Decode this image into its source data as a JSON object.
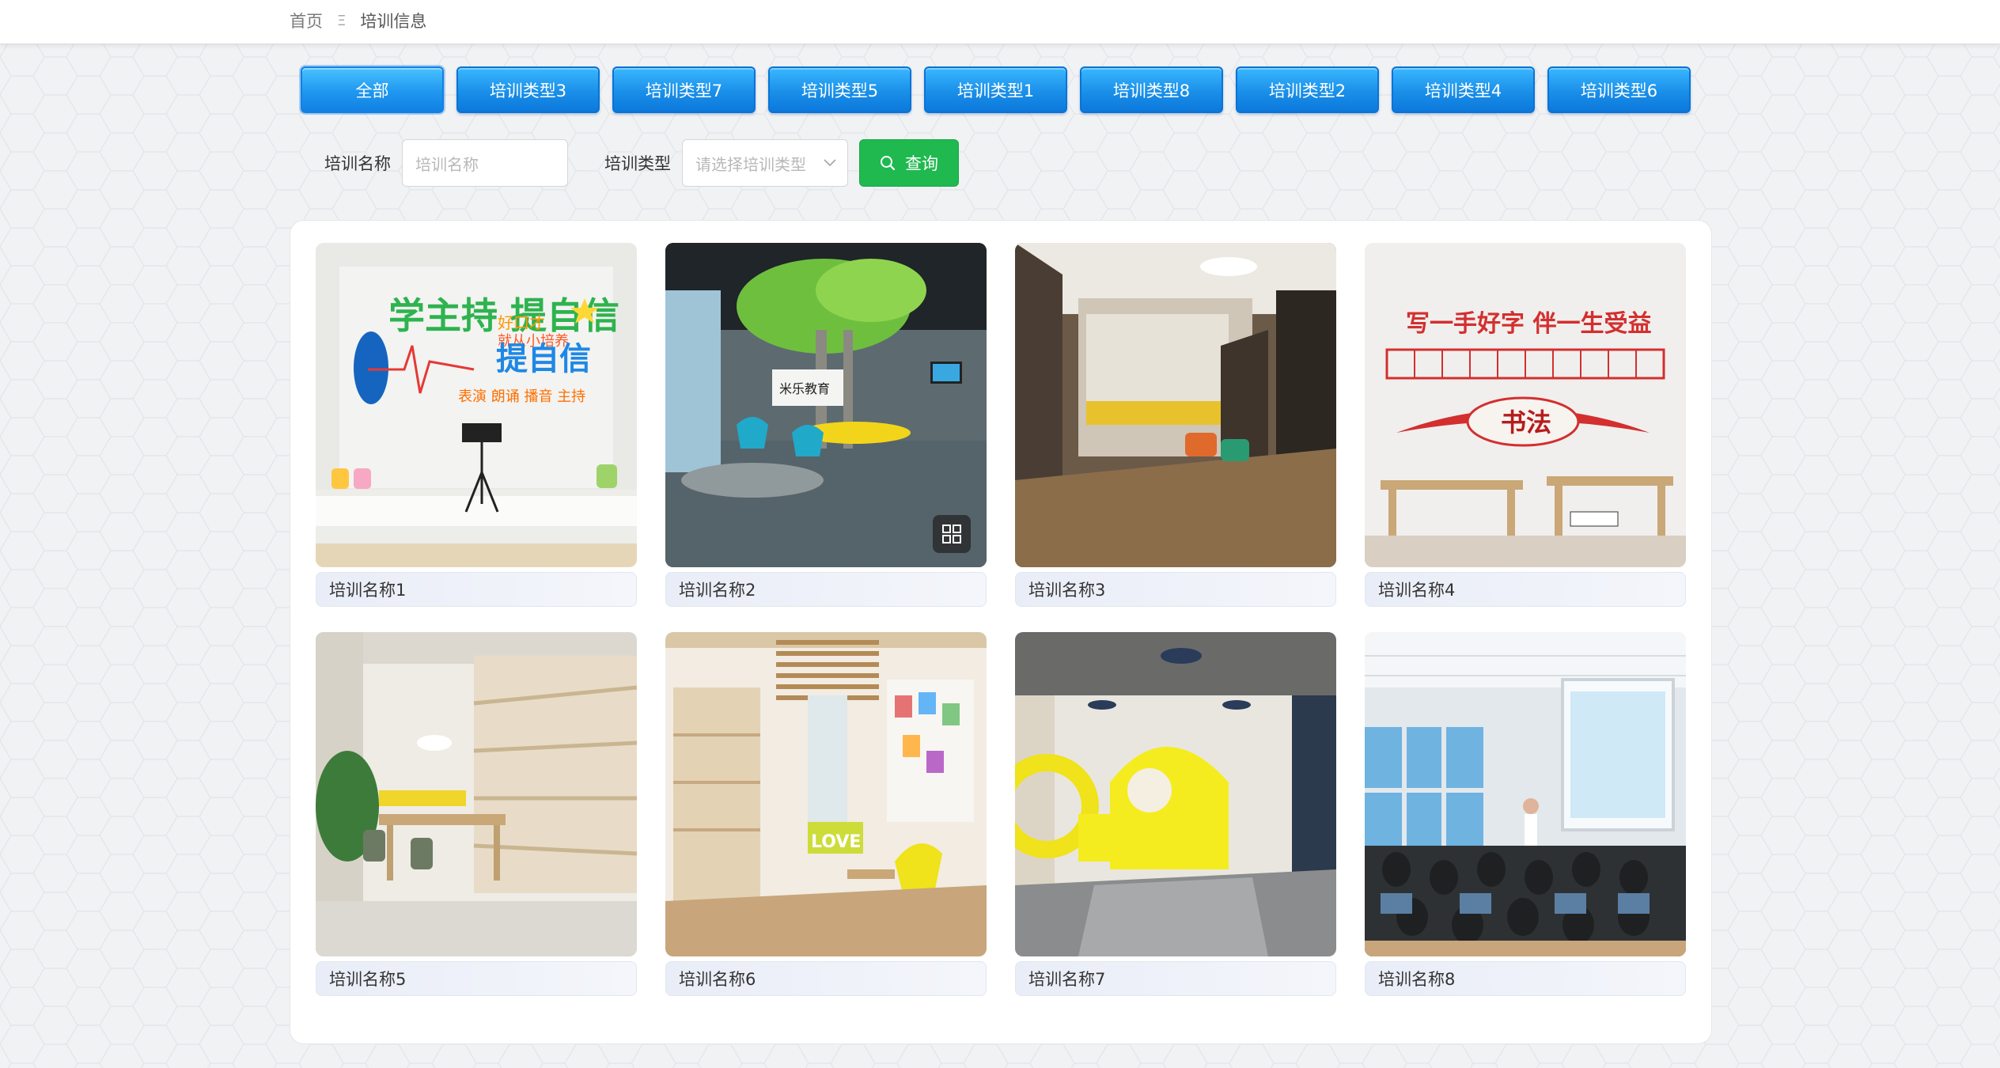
{
  "breadcrumb": {
    "home": "首页",
    "separator": "Ξ",
    "current": "培训信息"
  },
  "tabs": [
    "全部",
    "培训类型3",
    "培训类型7",
    "培训类型5",
    "培训类型1",
    "培训类型8",
    "培训类型2",
    "培训类型4",
    "培训类型6"
  ],
  "search": {
    "name_label": "培训名称",
    "name_placeholder": "培训名称",
    "type_label": "培训类型",
    "type_placeholder": "请选择培训类型",
    "query_label": "查询"
  },
  "cards": [
    {
      "title": "培训名称1",
      "sign": "学主持 提自信"
    },
    {
      "title": "培训名称2",
      "sign": "米乐教育"
    },
    {
      "title": "培训名称3"
    },
    {
      "title": "培训名称4",
      "sign": "写一手好字 伴一生受益",
      "sign2": "书法"
    },
    {
      "title": "培训名称5"
    },
    {
      "title": "培训名称6",
      "sign": "LOVE"
    },
    {
      "title": "培训名称7"
    },
    {
      "title": "培训名称8"
    }
  ],
  "colors": {
    "tab_blue": "#1a8fe8",
    "query_green": "#1fb94f"
  },
  "icons": {
    "search": "search-icon",
    "dropdown": "chevron-down-icon",
    "grid": "grid-icon"
  }
}
